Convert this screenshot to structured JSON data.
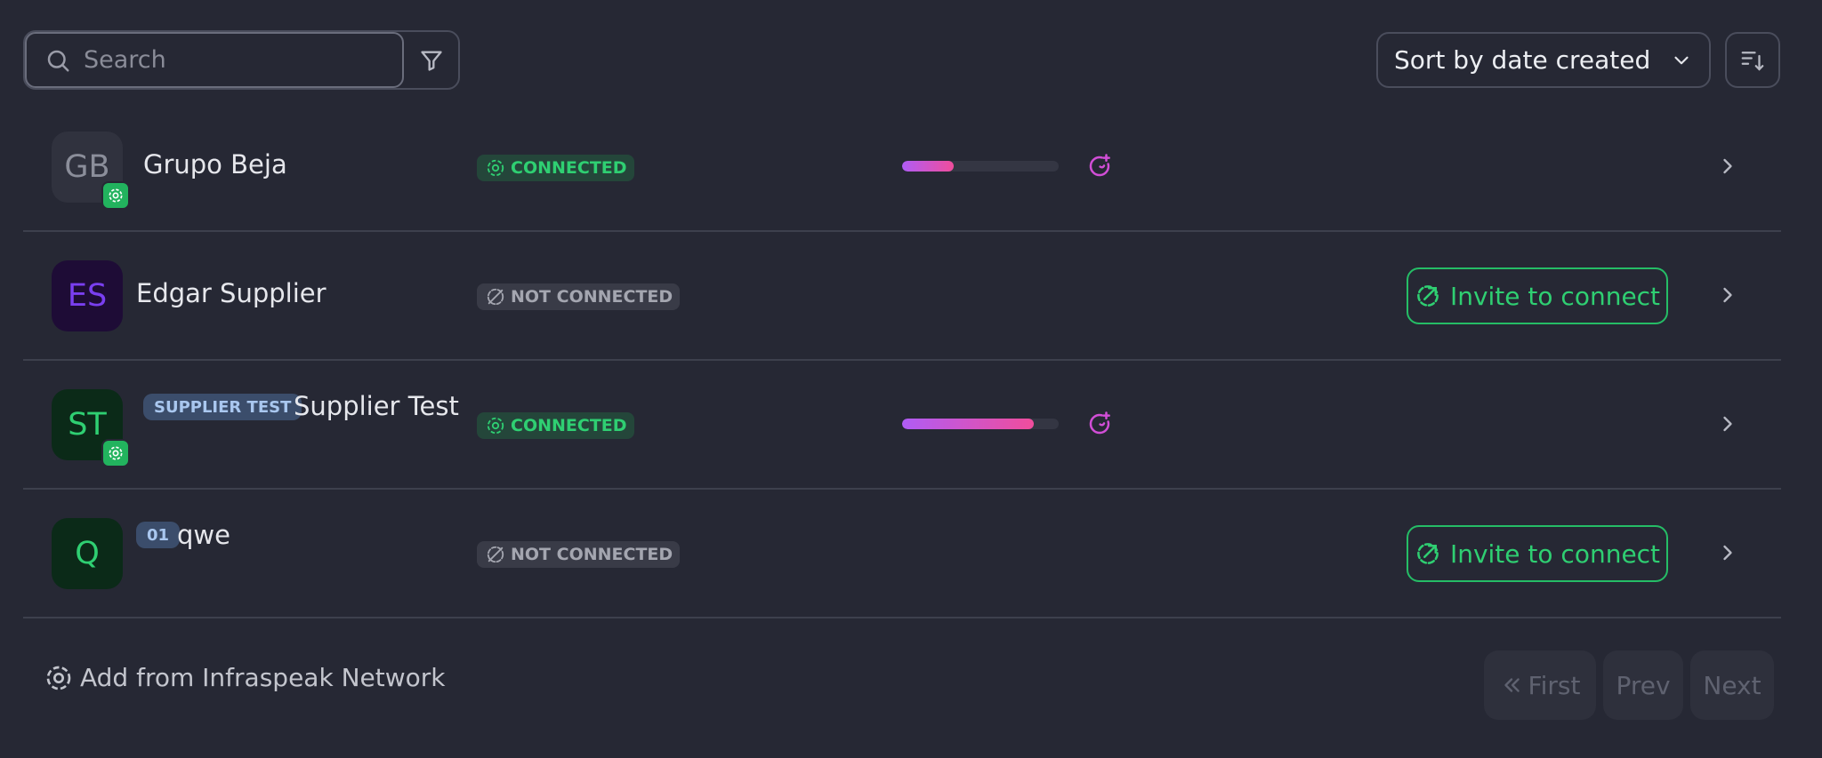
{
  "toolbar": {
    "search_placeholder": "Search",
    "sort_label": "Sort by date created"
  },
  "rows": [
    {
      "initials": "GB",
      "name": "Grupo Beja",
      "tag": "",
      "status": "CONNECTED",
      "progress": 0.33,
      "action": ""
    },
    {
      "initials": "ES",
      "name": "Edgar Supplier",
      "tag": "",
      "status": "NOT CONNECTED",
      "progress": null,
      "action": "Invite to connect"
    },
    {
      "initials": "ST",
      "name": "Supplier Test",
      "tag": "SUPPLIER TEST",
      "status": "CONNECTED",
      "progress": 0.84,
      "action": ""
    },
    {
      "initials": "Q",
      "name": "qwe",
      "tag": "01",
      "status": "NOT CONNECTED",
      "progress": null,
      "action": "Invite to connect"
    }
  ],
  "footer": {
    "add_network_label": "Add from Infraspeak Network",
    "first_label": "First",
    "prev_label": "Prev",
    "next_label": "Next"
  },
  "colors": {
    "background": "#262834",
    "connected_green": "#2fcf72",
    "progress_start": "#b05cf5",
    "progress_end": "#f04d9c"
  }
}
